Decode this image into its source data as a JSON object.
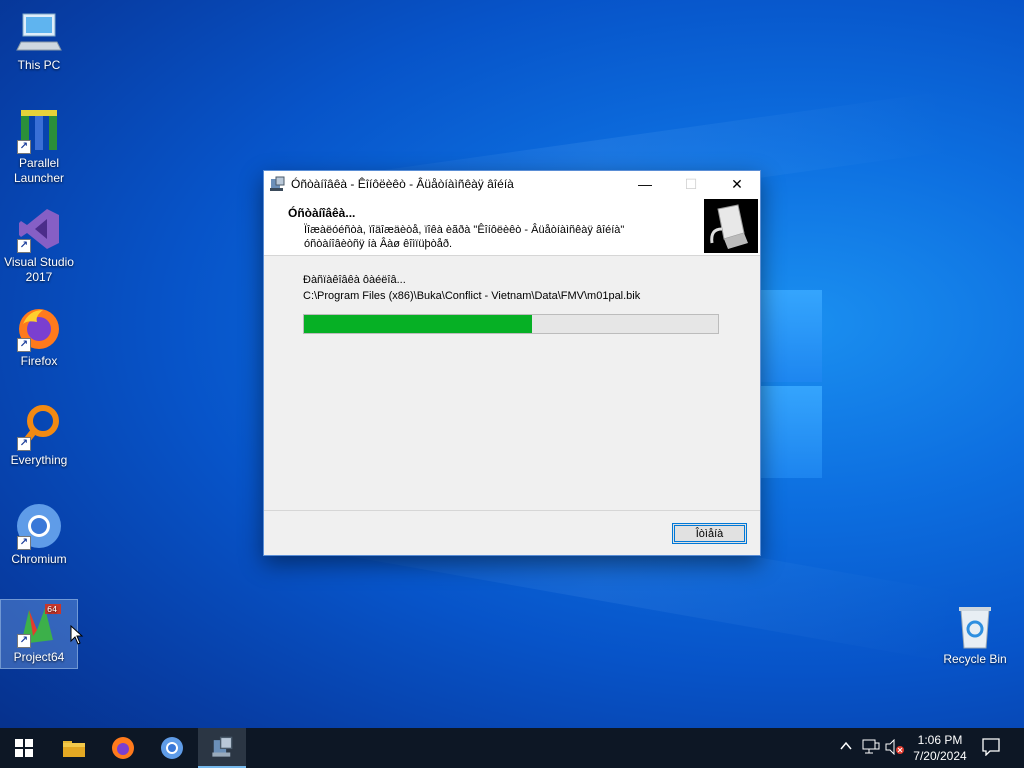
{
  "desktop": {
    "icons": [
      {
        "label": "This PC"
      },
      {
        "label": "Parallel Launcher"
      },
      {
        "label": "Visual Studio 2017"
      },
      {
        "label": "Firefox"
      },
      {
        "label": "Everything"
      },
      {
        "label": "Chromium"
      },
      {
        "label": "Project64"
      },
      {
        "label": "Recycle Bin"
      }
    ]
  },
  "dialog": {
    "title": "Óñòàíîâêà - Êîíôëèêò - Âüåòíàìñêàÿ âîéíà",
    "header_title": "Óñòàíîâêà...",
    "header_desc": "Ïîæàëóéñòà, ïîäîæäèòå, ïîêà èãðà \"Êîíôëèêò - Âüåòíàìñêàÿ âîéíà\" óñòàíîâèòñÿ íà Âàø êîìïüþòåð.",
    "status_text": "Ðàñïàêîâêà ôàéëîâ...",
    "current_file": "C:\\Program Files (x86)\\Buka\\Conflict - Vietnam\\Data\\FMV\\m01pal.bik",
    "progress_percent": 55,
    "cancel_label": "Îòìåíà",
    "minimize_symbol": "—",
    "maximize_symbol": "☐",
    "close_symbol": "✕"
  },
  "taskbar": {
    "items": [
      "start-icon",
      "file-explorer-icon",
      "firefox-icon",
      "chromium-icon",
      "setup-icon"
    ],
    "clock_time": "1:06 PM",
    "clock_date": "7/20/2024"
  },
  "colors": {
    "progress_fill": "#06b025",
    "accent": "#0078d7"
  }
}
